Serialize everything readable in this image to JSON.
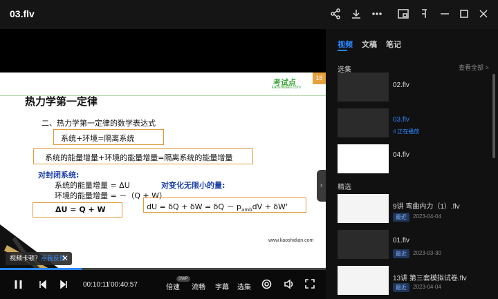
{
  "window": {
    "title": "03.flv"
  },
  "slide": {
    "title": "热力学第一定律",
    "logo": "考试点",
    "logo_sub": "kaoshidian.com",
    "page_num": "16",
    "line1": "二、热力学第一定律的数学表达式",
    "box1": "系统+环境=隔离系统",
    "box2": "系统的能量增量+环境的能量增量=隔离系统的能量增量",
    "closed_title": "对封闭系统:",
    "closed_line1": "系统的能量增量 = ΔU",
    "closed_line2": "环境的能量增量 = －（Q + W）",
    "infinitesimal": "对变化无限小的量:",
    "eq1": "ΔU = Q + W",
    "eq2": "dU = δQ + δW = δQ － p",
    "eq2_sub": "amb",
    "eq2_tail": "dV + δW'",
    "url": "www.kaoshidian.com"
  },
  "player": {
    "toast_text": "视频卡顿？",
    "toast_link": "点我反馈",
    "time_current": "00:10:11",
    "time_total": "00:40:57",
    "speed_label": "倍速",
    "speed_badge": "SWP",
    "quality_label": "流畅",
    "subtitle_label": "字幕",
    "episodes_label": "选集",
    "progress": 0.25
  },
  "panel": {
    "tabs": [
      "视频",
      "文稿",
      "笔记"
    ],
    "section_episodes": "选集",
    "view_all": "查看全部 >",
    "section_featured": "精选",
    "episodes": [
      {
        "title": "02.flv",
        "status": ""
      },
      {
        "title": "03.flv",
        "status": "正在播放"
      },
      {
        "title": "04.flv",
        "status": ""
      }
    ],
    "featured": [
      {
        "title": "9讲  弯曲内力（1）.flv",
        "badge": "最近",
        "date": "2023-04-04"
      },
      {
        "title": "01.flv",
        "badge": "最近",
        "date": "2023-03-30"
      },
      {
        "title": "13讲  第三套模拟试卷.flv",
        "badge": "最近",
        "date": "2023-04-04"
      }
    ]
  },
  "colors": {
    "accent": "#2b86ff",
    "box_border": "#e09a3a",
    "slide_blue": "#1a3fa6"
  }
}
